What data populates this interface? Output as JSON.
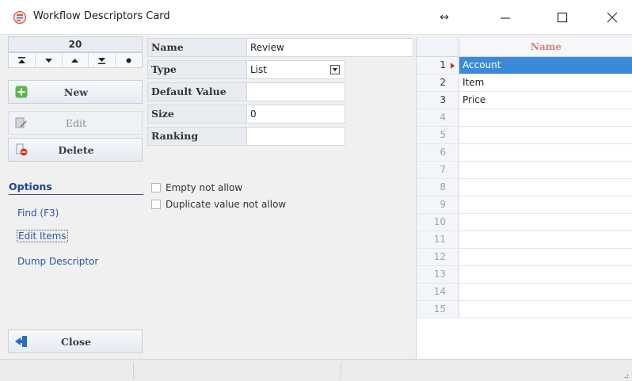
{
  "window": {
    "title": "Workflow Descriptors Card",
    "resize_glyph": "↔",
    "controls": {
      "minimize": "minimize-icon",
      "maximize": "maximize-icon",
      "close": "close-icon"
    }
  },
  "navigator": {
    "counter": "20",
    "buttons": [
      "first-record-icon",
      "previous-record-icon",
      "next-record-icon",
      "last-record-icon",
      "current-record-icon"
    ]
  },
  "actions": {
    "new_label": "New",
    "edit_label": "Edit",
    "delete_label": "Delete",
    "close_label": "Close"
  },
  "options": {
    "title": "Options",
    "find": "Find  (F3)",
    "edit_items": "Edit Items",
    "dump": "Dump Descriptor"
  },
  "form": {
    "name_label": "Name",
    "name_value": "Review",
    "type_label": "Type",
    "type_value": "List",
    "default_label": "Default Value",
    "default_value": "",
    "size_label": "Size",
    "size_value": "0",
    "ranking_label": "Ranking",
    "ranking_value": ""
  },
  "checkboxes": {
    "empty_not_allow": "Empty not allow",
    "duplicate_not_allow": "Duplicate value not allow"
  },
  "grid": {
    "column": "Name",
    "rows": [
      {
        "num": "1",
        "value": "Account"
      },
      {
        "num": "2",
        "value": "Item"
      },
      {
        "num": "3",
        "value": "Price"
      },
      {
        "num": "4",
        "value": ""
      },
      {
        "num": "5",
        "value": ""
      },
      {
        "num": "6",
        "value": ""
      },
      {
        "num": "7",
        "value": ""
      },
      {
        "num": "8",
        "value": ""
      },
      {
        "num": "9",
        "value": ""
      },
      {
        "num": "10",
        "value": ""
      },
      {
        "num": "11",
        "value": ""
      },
      {
        "num": "12",
        "value": ""
      },
      {
        "num": "13",
        "value": ""
      },
      {
        "num": "14",
        "value": ""
      },
      {
        "num": "15",
        "value": ""
      }
    ]
  },
  "colors": {
    "accent": "#3b8ad9",
    "options_title": "#1e3f93",
    "link": "#2a55a8",
    "grid_header": "#d9827a"
  }
}
